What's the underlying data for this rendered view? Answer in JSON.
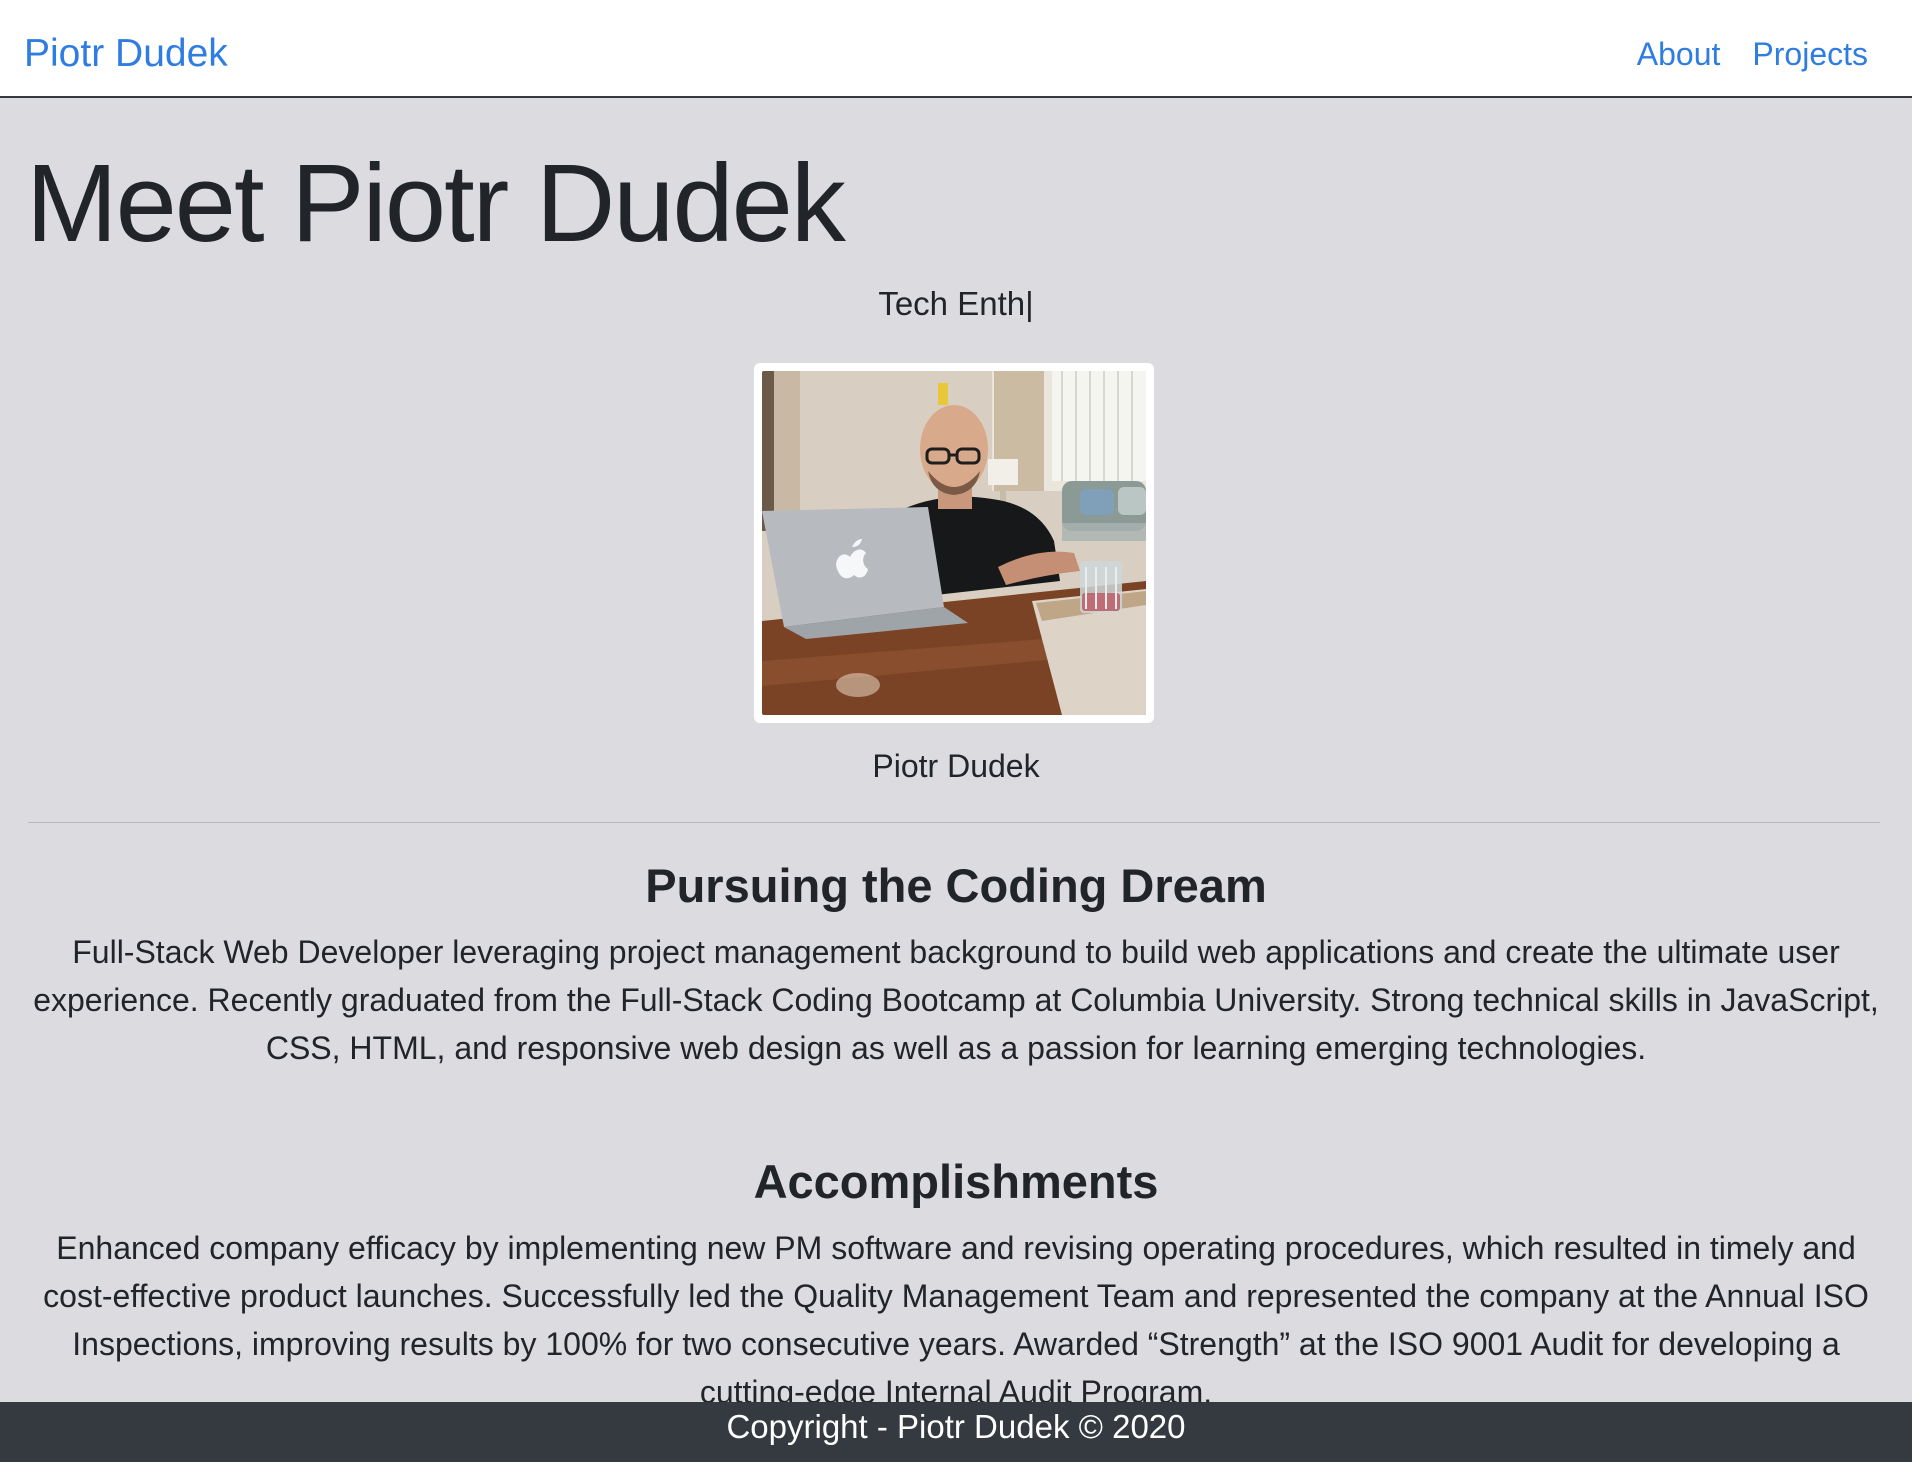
{
  "nav": {
    "brand": "Piotr Dudek",
    "links": [
      "About",
      "Projects"
    ]
  },
  "hero": {
    "title": "Meet Piotr Dudek",
    "typed_text": "Tech Enth|",
    "photo_caption": "Piotr Dudek"
  },
  "sections": [
    {
      "heading": "Pursuing the Coding Dream",
      "text": "Full-Stack Web Developer leveraging project management background to build web applications and create the ultimate user experience. Recently graduated from the Full-Stack Coding Bootcamp at Columbia University. Strong technical skills in JavaScript, CSS, HTML, and responsive web design as well as a passion for learning emerging technologies."
    },
    {
      "heading": "Accomplishments",
      "text": "Enhanced company efficacy by implementing new PM software and revising operating procedures, which resulted in timely and cost-effective product launches. Successfully led the Quality Management Team and represented the company at the Annual ISO Inspections, improving results by 100% for two consecutive years. Awarded “Strength” at the ISO 9001 Audit for developing a cutting-edge Internal Audit Program."
    }
  ],
  "footer": {
    "text": "Copyright - Piotr Dudek © 2020"
  },
  "colors": {
    "link": "#2f7de1",
    "main_bg": "#dcdbe0",
    "footer_bg": "#343a40"
  }
}
